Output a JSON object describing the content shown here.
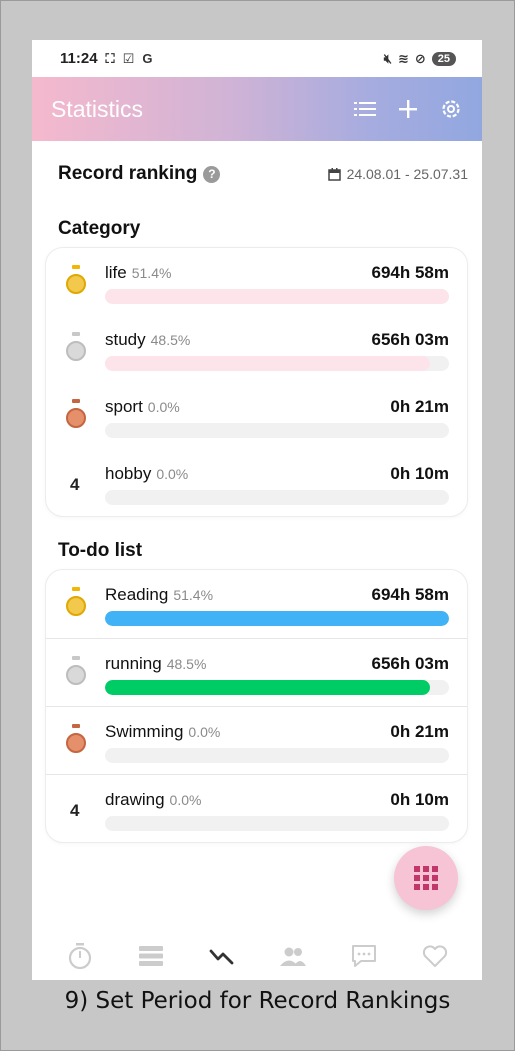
{
  "status_bar": {
    "time": "11:24",
    "battery": "25"
  },
  "header": {
    "title": "Statistics"
  },
  "ranking": {
    "title": "Record ranking",
    "help": "?",
    "period": "24.08.01 - 25.07.31"
  },
  "category": {
    "title": "Category",
    "items": [
      {
        "rank": 1,
        "name": "life",
        "percent": "51.4%",
        "time": "694h 58m",
        "progress": 1.0,
        "color": "#fde3ea"
      },
      {
        "rank": 2,
        "name": "study",
        "percent": "48.5%",
        "time": "656h 03m",
        "progress": 0.944,
        "color": "#fde3ea"
      },
      {
        "rank": 3,
        "name": "sport",
        "percent": "0.0%",
        "time": "0h 21m",
        "progress": 0.0,
        "color": "#fde3ea"
      },
      {
        "rank": "4",
        "name": "hobby",
        "percent": "0.0%",
        "time": "0h 10m",
        "progress": 0.0,
        "color": "#fde3ea"
      }
    ]
  },
  "todo": {
    "title": "To-do list",
    "items": [
      {
        "rank": 1,
        "name": "Reading",
        "percent": "51.4%",
        "time": "694h 58m",
        "progress": 1.0,
        "color": "#41b2f5"
      },
      {
        "rank": 2,
        "name": "running",
        "percent": "48.5%",
        "time": "656h 03m",
        "progress": 0.944,
        "color": "#00cc66"
      },
      {
        "rank": 3,
        "name": "Swimming",
        "percent": "0.0%",
        "time": "0h 21m",
        "progress": 0.0,
        "color": "#41b2f5"
      },
      {
        "rank": "4",
        "name": "drawing",
        "percent": "0.0%",
        "time": "0h 10m",
        "progress": 0.0,
        "color": "#41b2f5"
      }
    ]
  },
  "colors": {
    "gold": "#f2c94c",
    "silver": "#d9d9d9",
    "bronze": "#e58f6b",
    "accent_fab": "#f6c4d4",
    "fab_icon": "#c0386a"
  },
  "nav": [
    "timer-icon",
    "list-icon",
    "statistics-icon",
    "friends-icon",
    "chat-icon",
    "heart-icon"
  ],
  "caption": "9) Set Period for Record Rankings"
}
